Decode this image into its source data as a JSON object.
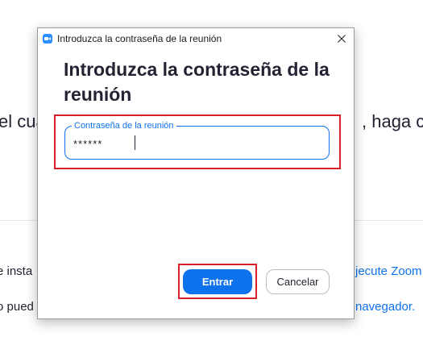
{
  "background": {
    "line1_left": "el cua",
    "line1_right": ", haga c",
    "line2_left": "e insta",
    "line2_right": "jecute Zoom",
    "line3_left": "o pued",
    "line3_right": "navegador."
  },
  "dialog": {
    "window_title": "Introduzca la contraseña de la reunión",
    "heading": "Introduzca la contraseña de la reunión",
    "password": {
      "label": "Contraseña de la reunión",
      "value": "******",
      "placeholder": ""
    },
    "buttons": {
      "enter_label": "Entrar",
      "cancel_label": "Cancelar"
    },
    "icons": {
      "app": "zoom-camera-icon",
      "close": "close-icon"
    }
  },
  "colors": {
    "accent": "#0e72ed",
    "highlight": "#d8202a",
    "text": "#232333"
  }
}
